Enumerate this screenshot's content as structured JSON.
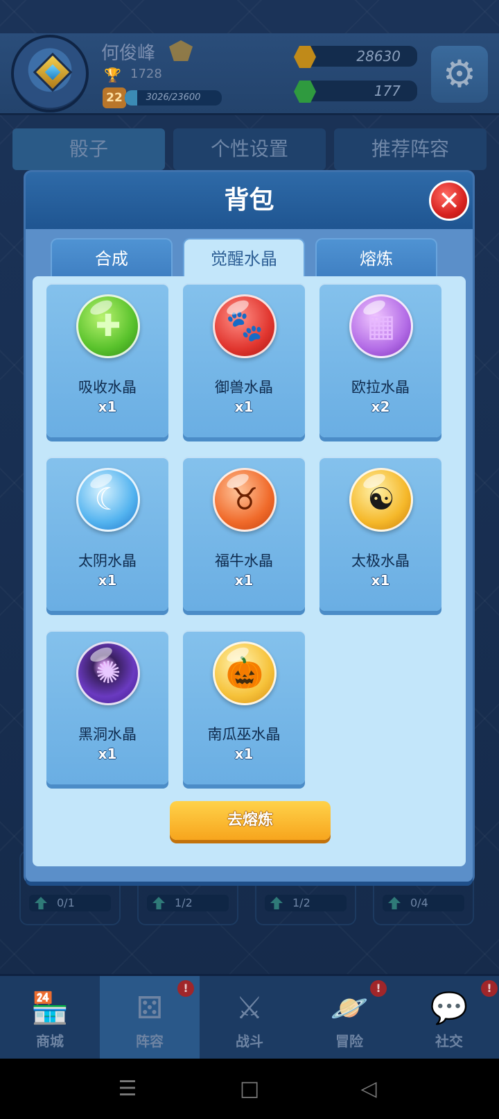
{
  "player": {
    "name": "何俊峰",
    "trophies": "1728",
    "level": "22",
    "xp_text": "3026/23600",
    "xp_fraction": 0.128
  },
  "currency": {
    "coins": "28630",
    "gems": "177"
  },
  "background_tabs": [
    "骰子",
    "个性设置",
    "推荐阵容"
  ],
  "background_cards": [
    "0/1",
    "1/2",
    "1/2",
    "0/4"
  ],
  "modal": {
    "title": "背包",
    "close_icon": "✕",
    "tabs": [
      "合成",
      "觉醒水晶",
      "熔炼"
    ],
    "active_tab": 1,
    "items": [
      {
        "name": "吸收水晶",
        "qty": "x1",
        "icon": "plus-cross-icon",
        "color": "green"
      },
      {
        "name": "御兽水晶",
        "qty": "x1",
        "icon": "paw-icon",
        "color": "red"
      },
      {
        "name": "欧拉水晶",
        "qty": "x2",
        "icon": "pixel-face-icon",
        "color": "purple"
      },
      {
        "name": "太阴水晶",
        "qty": "x1",
        "icon": "crescent-moon-icon",
        "color": "blue"
      },
      {
        "name": "福牛水晶",
        "qty": "x1",
        "icon": "bull-icon",
        "color": "orange"
      },
      {
        "name": "太极水晶",
        "qty": "x1",
        "icon": "yin-yang-icon",
        "color": "gold"
      },
      {
        "name": "黑洞水晶",
        "qty": "x1",
        "icon": "galaxy-icon",
        "color": "dark"
      },
      {
        "name": "南瓜巫水晶",
        "qty": "x1",
        "icon": "pumpkin-icon",
        "color": "pumpkin"
      }
    ],
    "smelt_button": "去熔炼"
  },
  "bottom_nav": [
    {
      "label": "商城",
      "icon": "shop-icon",
      "badge": ""
    },
    {
      "label": "阵容",
      "icon": "dice-icon",
      "badge": "!"
    },
    {
      "label": "战斗",
      "icon": "swords-icon",
      "badge": ""
    },
    {
      "label": "冒险",
      "icon": "planet-icon",
      "badge": "!"
    },
    {
      "label": "社交",
      "icon": "chat-icon",
      "badge": "!"
    }
  ]
}
